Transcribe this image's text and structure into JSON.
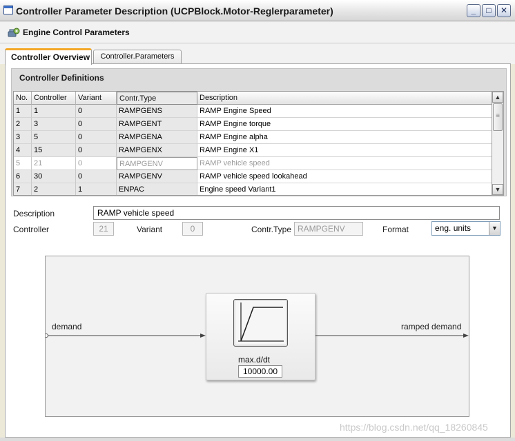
{
  "window": {
    "title": "Controller Parameter Description (UCPBlock.Motor-Reglerparameter)",
    "buttons": [
      "_",
      "□",
      "✕"
    ]
  },
  "header": {
    "title": "Engine Control Parameters",
    "icon": "engine-gear-icon"
  },
  "tabs": [
    {
      "label": "Controller Overview",
      "active": true
    },
    {
      "label": "Controller.Parameters",
      "active": false
    }
  ],
  "section": {
    "title": "Controller Definitions"
  },
  "table": {
    "columns": [
      "No.",
      "Controller",
      "Variant",
      "Contr.Type",
      "Description"
    ],
    "rows": [
      {
        "no": "1",
        "controller": "1",
        "variant": "0",
        "type": "RAMPGENS",
        "description": "RAMP Engine Speed"
      },
      {
        "no": "2",
        "controller": "3",
        "variant": "0",
        "type": "RAMPGENT",
        "description": "RAMP Engine torque"
      },
      {
        "no": "3",
        "controller": "5",
        "variant": "0",
        "type": "RAMPGENA",
        "description": "RAMP Engine alpha"
      },
      {
        "no": "4",
        "controller": "15",
        "variant": "0",
        "type": "RAMPGENX",
        "description": "RAMP Engine X1"
      },
      {
        "no": "5",
        "controller": "21",
        "variant": "0",
        "type": "RAMPGENV",
        "description": "RAMP vehicle speed"
      },
      {
        "no": "6",
        "controller": "30",
        "variant": "0",
        "type": "RAMPGENV",
        "description": "RAMP vehicle speed lookahead"
      },
      {
        "no": "7",
        "controller": "2",
        "variant": "1",
        "type": "ENPAC",
        "description": "Engine speed Variant1"
      }
    ],
    "selected_row": 4
  },
  "form": {
    "description_label": "Description",
    "description_value": "RAMP vehicle speed",
    "controller_label": "Controller",
    "controller_value": "21",
    "variant_label": "Variant",
    "variant_value": "0",
    "type_label": "Contr.Type",
    "type_value": "RAMPGENV",
    "format_label": "Format",
    "format_value": "eng. units"
  },
  "diagram": {
    "input_label": "demand",
    "output_label": "ramped demand",
    "block_param_label": "max.d/dt",
    "block_param_value": "10000.00"
  },
  "watermark": "https://blog.csdn.net/qq_18260845",
  "colors": {
    "active_tab_accent": "#f3a829",
    "window_bg": "#ece9d8",
    "panel_bg": "#ffffff"
  }
}
